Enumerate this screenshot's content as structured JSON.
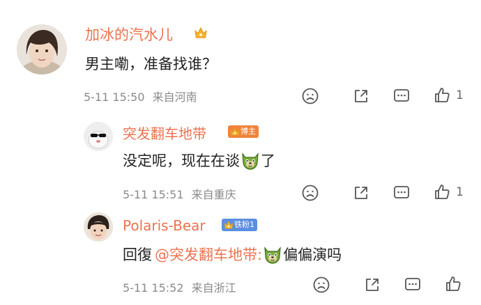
{
  "colors": {
    "accent": "#eb7350",
    "text": "#222222",
    "meta": "#8a8a8a",
    "icon": "#666666"
  },
  "comments": [
    {
      "username": "加冰的汽水儿",
      "text": "男主嘞，准备找谁？",
      "time": "5-11 15:50",
      "location": "来自河南",
      "like_count": "1",
      "badge_icon": "crown-icon"
    },
    {
      "username": "突发翻车地带",
      "tag": "博主",
      "text_before": "没定呢，现在在谈",
      "text_after": "了",
      "emoji": "dog-emoji",
      "time": "5-11 15:51",
      "location": "来自重庆",
      "like_count": "1"
    },
    {
      "username": "Polaris-Bear",
      "tag": "铁粉1",
      "reply_prefix": "回復",
      "mention": "@突发翻车地带:",
      "text_after": "偏偏演吗",
      "emoji": "dog-emoji",
      "time": "5-11 15:52",
      "location": "来自浙江"
    }
  ]
}
